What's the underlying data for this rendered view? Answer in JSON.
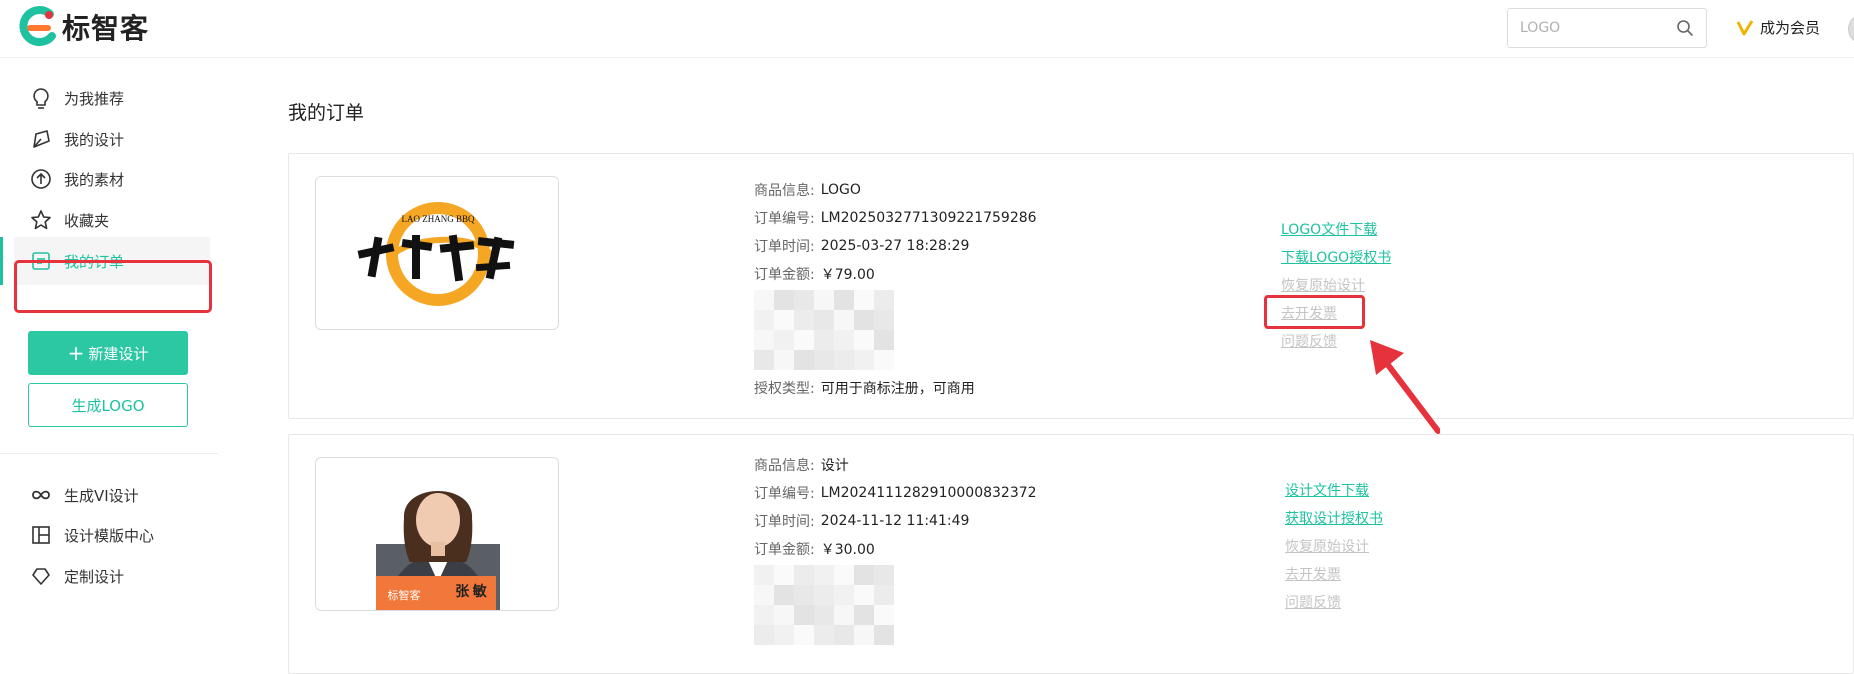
{
  "header": {
    "brand": "标智客",
    "search_placeholder": "LOGO",
    "member_label": "成为会员"
  },
  "sidebar": {
    "items": [
      {
        "label": "为我推荐",
        "icon": "bulb-icon"
      },
      {
        "label": "我的设计",
        "icon": "design-icon"
      },
      {
        "label": "我的素材",
        "icon": "upload-icon"
      },
      {
        "label": "收藏夹",
        "icon": "star-icon"
      },
      {
        "label": "我的订单",
        "icon": "order-icon",
        "active": true
      }
    ],
    "new_design_label": "新建设计",
    "generate_logo_label": "生成LOGO",
    "extra_items": [
      {
        "label": "生成VI设计",
        "icon": "infinity-icon"
      },
      {
        "label": "设计模版中心",
        "icon": "layout-icon"
      },
      {
        "label": "定制设计",
        "icon": "diamond-icon"
      }
    ]
  },
  "main": {
    "title": "我的订单",
    "orders": [
      {
        "labels": {
          "product": "商品信息:",
          "number": "订单编号:",
          "time": "订单时间:",
          "amount": "订单金额:",
          "license": "授权类型:"
        },
        "product": "LOGO",
        "number": "LM2025032771309221759286",
        "time": "2025-03-27 18:28:29",
        "amount": "￥79.00",
        "license": "可用于商标注册，可商用",
        "thumb_brand_text": "LAO ZHANG BBQ",
        "actions": [
          {
            "label": "LOGO文件下载",
            "enabled": true
          },
          {
            "label": "下载LOGO授权书",
            "enabled": true
          },
          {
            "label": "恢复原始设计",
            "enabled": false
          },
          {
            "label": "去开发票",
            "enabled": false
          },
          {
            "label": "问题反馈",
            "enabled": false
          }
        ]
      },
      {
        "labels": {
          "product": "商品信息:",
          "number": "订单编号:",
          "time": "订单时间:",
          "amount": "订单金额:"
        },
        "product": "设计",
        "number": "LM2024111282910000832372",
        "time": "2024-11-12 11:41:49",
        "amount": "￥30.00",
        "thumb_card_brand": "标智客",
        "thumb_card_name": "张 敏",
        "actions": [
          {
            "label": "设计文件下载",
            "enabled": true
          },
          {
            "label": "获取设计授权书",
            "enabled": true
          },
          {
            "label": "恢复原始设计",
            "enabled": false
          },
          {
            "label": "去开发票",
            "enabled": false
          },
          {
            "label": "问题反馈",
            "enabled": false
          }
        ]
      }
    ]
  },
  "colors": {
    "accent": "#2cc8a4",
    "annotation": "#e5323c"
  }
}
